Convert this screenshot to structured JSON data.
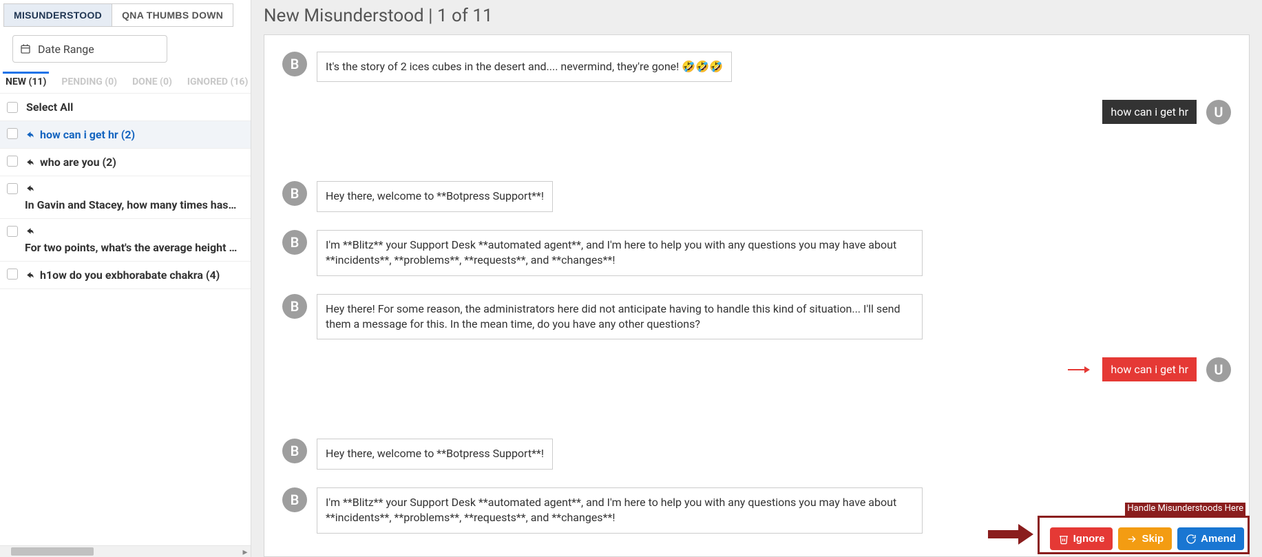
{
  "tabs": {
    "misunderstood": "MISUNDERSTOOD",
    "qna": "QNA THUMBS DOWN"
  },
  "dateRange": "Date Range",
  "statusTabs": {
    "new": "NEW (11)",
    "pending": "PENDING (0)",
    "done": "DONE (0)",
    "ignored": "IGNORED (16)"
  },
  "selectAll": "Select All",
  "items": [
    {
      "text": "how can i get hr (2)"
    },
    {
      "text": "who are you (2)"
    },
    {
      "text": "In Gavin and Stacey, how many times has Sta"
    },
    {
      "text": "For two points, what's the average height of m"
    },
    {
      "text": "h1ow do you exbhorabate chakra (4)"
    }
  ],
  "pageTitle": "New Misunderstood | 1 of 11",
  "messages": {
    "b1": "It's the story of 2 ices cubes in the desert and.... nevermind, they're gone! 🤣🤣🤣",
    "u1": "how can i get hr",
    "b2": "Hey there, welcome to **Botpress Support**!",
    "b3": "I'm **Blitz** your Support Desk **automated agent**, and I'm here to help you with any questions you may have about **incidents**, **problems**, **requests**, and **changes**!",
    "b4": "Hey there! For some reason, the administrators here did not anticipate having to handle this kind of situation... I'll send them a message for this. In the mean time, do you have any other questions?",
    "u2": "how can i get hr",
    "b5": "Hey there, welcome to **Botpress Support**!",
    "b6": "I'm **Blitz** your Support Desk **automated agent**, and I'm here to help you with any questions you may have about **incidents**, **problems**, **requests**, and **changes**!"
  },
  "avatars": {
    "bot": "B",
    "user": "U"
  },
  "actions": {
    "ignore": "Ignore",
    "skip": "Skip",
    "amend": "Amend"
  },
  "annotation": "Handle Misunderstoods Here"
}
